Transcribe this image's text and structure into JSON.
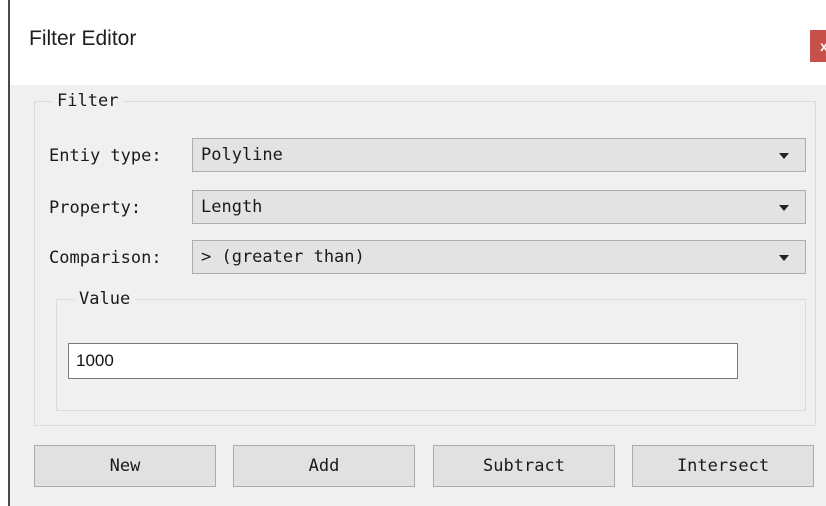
{
  "window": {
    "title": "Filter Editor",
    "close_label": "x"
  },
  "filter_group": {
    "legend": "Filter",
    "entity_type": {
      "label": "Entiy type:",
      "selected": "Polyline"
    },
    "property": {
      "label": "Property:",
      "selected": "Length"
    },
    "comparison": {
      "label": "Comparison:",
      "selected": "> (greater than)"
    }
  },
  "value_group": {
    "legend": "Value",
    "value": "1000"
  },
  "buttons": {
    "new": "New",
    "add": "Add",
    "subtract": "Subtract",
    "intersect": "Intersect"
  },
  "colors": {
    "close_button": "#c8504b",
    "dialog_background": "#f0f0f0",
    "button_face": "#e1e1e1"
  },
  "icons": {
    "dropdown": "chevron-down-icon",
    "close": "close-icon"
  }
}
